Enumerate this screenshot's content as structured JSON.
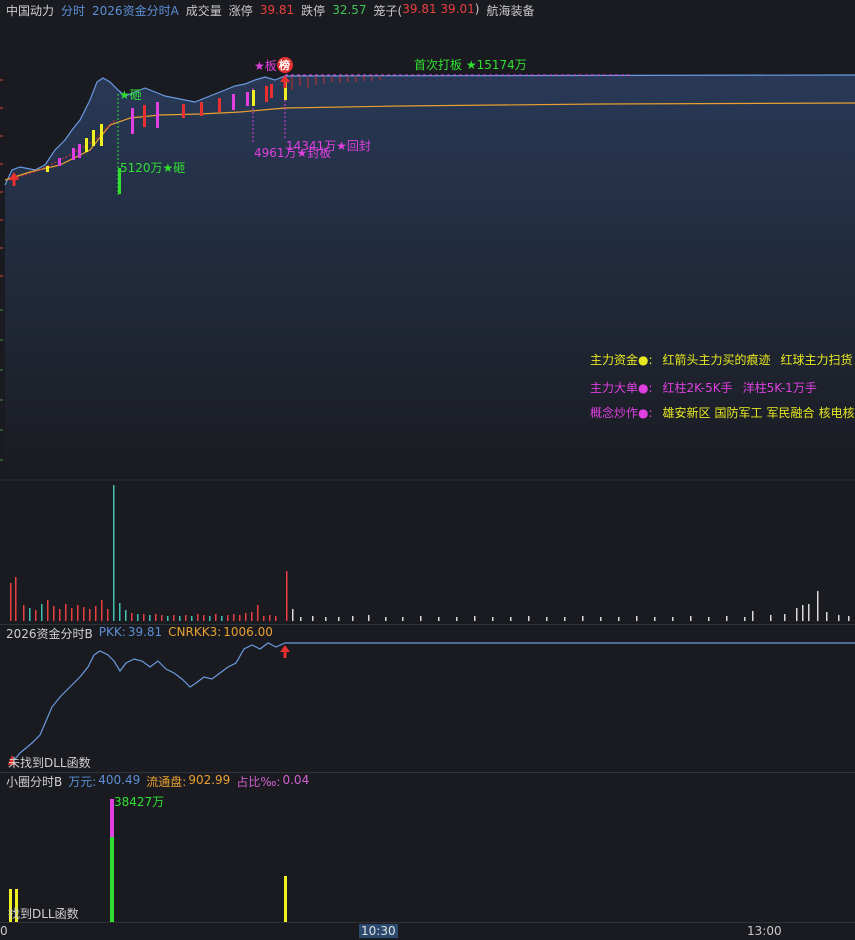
{
  "header": {
    "stock_name": "中国动力",
    "tab1": "分时",
    "tab2": "2026资金分时A",
    "volume_label": "成交量",
    "limit_up_label": "涨停",
    "limit_up_value": "39.81",
    "limit_down_label": "跌停",
    "limit_down_value": "32.57",
    "cage_label": "笼子(",
    "cage_high": "39.81",
    "cage_low": "39.01",
    "cage_close": ")",
    "sector": "航海装备"
  },
  "main_chart": {
    "annotations": {
      "smash": "★砸",
      "smash_amount": "5120万★砸",
      "board": "★板",
      "rank_badge": "榜",
      "seal": "4961万★封板",
      "reseal": "14341万★回封",
      "first_board": "首次打板 ★15174万"
    },
    "legend": {
      "row1_key": "主力资金●:",
      "row1_a": "红箭头主力买的痕迹",
      "row1_b": "红球主力扫货",
      "row2_key": "主力大单●:",
      "row2_a": "红柱2K-5K手",
      "row2_b": "洋柱5K-1万手",
      "row3_key": "概念炒作●:",
      "row3_a": "雄安新区",
      "row3_b": "国防军工",
      "row3_c": "军民融合",
      "row3_d": "核电核能"
    }
  },
  "indicator_b": {
    "title": "2026资金分时B",
    "pkk_label": "PKK:",
    "pkk_value": "39.81",
    "cnrkk_label": "CNRKK3:",
    "cnrkk_value": "1006.00",
    "dll_text": "未找到DLL函数"
  },
  "small_circle": {
    "title": "小圈分时B",
    "wan_label": "万元:",
    "wan_value": "400.49",
    "float_label": "流通盘:",
    "float_value": "902.99",
    "ratio_label": "占比‰:",
    "ratio_value": "0.04",
    "peak_label": "38427万",
    "dll_text": "找到DLL函数"
  },
  "time_axis": {
    "left_label": "0",
    "mid_label": "10:30",
    "right_label": "13:00"
  },
  "colors": {
    "background": "#1a1b20",
    "price_line": "#5b8fd6",
    "avg_line": "#e8a030",
    "up_red": "#e83030",
    "magenta": "#e040e0",
    "yellow": "#f0f020",
    "green": "#30e030"
  }
}
